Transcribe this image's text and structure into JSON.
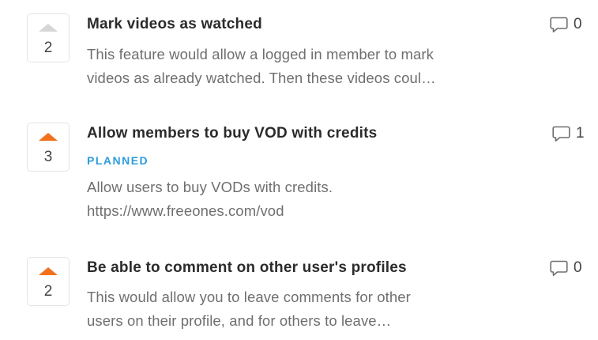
{
  "posts": [
    {
      "title": "Mark videos as watched",
      "votes": "2",
      "voted": false,
      "status": "",
      "description_lines": [
        "This feature would allow a logged in member to mark",
        "videos as already watched. Then these videos coul…"
      ],
      "comments": "0"
    },
    {
      "title": "Allow members to buy VOD with credits",
      "votes": "3",
      "voted": true,
      "status": "PLANNED",
      "description_lines": [
        "Allow users to buy VODs with credits.",
        "https://www.freeones.com/vod"
      ],
      "comments": "1"
    },
    {
      "title": "Be able to comment on other user's profiles",
      "votes": "2",
      "voted": true,
      "status": "",
      "description_lines": [
        "This would allow you to leave comments for other",
        "users on their profile, and for others to leave…"
      ],
      "comments": "0"
    }
  ],
  "colors": {
    "upvote_active": "#f2711c",
    "upvote_inactive": "#d6d6d6",
    "status_planned": "#2d9cdb",
    "title": "#2b2b2b",
    "description": "#6f6f6f"
  },
  "icons": {
    "upvote": "triangle-up-icon",
    "comment": "speech-bubble-icon"
  }
}
